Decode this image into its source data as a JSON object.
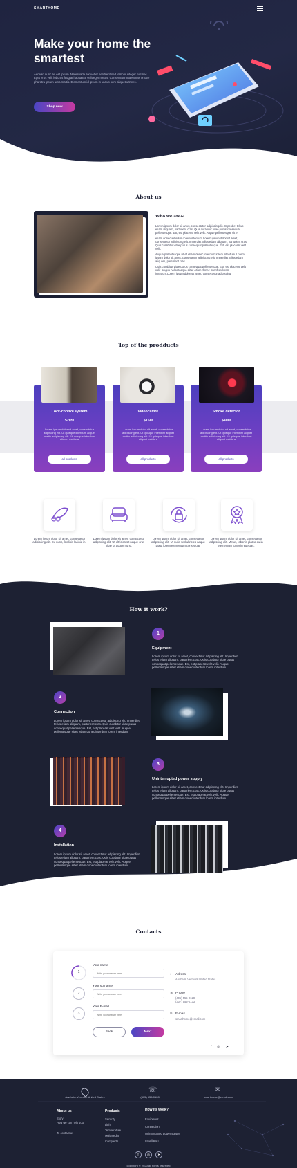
{
  "header": {
    "logo": "SMARTHOME",
    "menu_icon": "hamburger-icon"
  },
  "hero": {
    "title": "Make your home the smartest",
    "text": "Aenean nunc ac est ipsum. Malesuada aliquet et hendrerit sed tempor integer nisl nec. Eget eros velit lobortis feugiat habitasse velit eget metus. Consectetur maecenas ornare pharetra ipsum urna mattis. Elementum id ipsum in varius sem aliquet ultrices.",
    "button": "Shop now"
  },
  "about": {
    "title": "About us",
    "heading": "Who we are&",
    "p1": "Lorem ipsum dolor sit amet, consectetur adipiscingelit. Imperdiet tellus etiam aliquam, parturient cras. Quis curabitur vitae purus consequat pellentesque. Est, est placerat velit velit. Augue pellentesque sit et",
    "p2": "etiam donec interdum lorem interdum.Lorem ipsum dolor sit amet, consectetur adipiscing elit. Imperdiet tellus etiam aliquam, parturient cras. Quis curabitur vitae purus consequat pellentesque. Est, est placerat velit velit.",
    "p3": "Augue pellentesque sit et etiam donec interdum lorem interdum. Lorem ipsum dolor sit amet, consectetur adipiscing elit. Imperdiet tellus etiam aliquam, parturient cras.",
    "p4": "Quis curabitur vitae purus consequat pellentesque. Est, est placerat velit velit. Augue pellentesque sit et etiam donec interdum lorem interdum.Lorem ipsum dolor sit amet, consectetur adipiscing"
  },
  "products": {
    "title": "Top of the prodducts",
    "items": [
      {
        "name": "Lock-control system",
        "price": "$205/",
        "text": "Lorem ipsum dolor sit amet, consectetur adipiscing elit. Ut quisque interdum aliquet mattis adipiscing elit. Ut quisque interdum aliquet mattis a",
        "button": "all products"
      },
      {
        "name": "videocamre",
        "price": "$150/",
        "text": "Lorem ipsum dolor sit amet, consectetur adipiscing elit. Ut quisque interdum aliquet mattis adipiscing elit. Ut quisque interdum aliquet mattis a",
        "button": "all products"
      },
      {
        "name": "Smoke detector",
        "price": "$400/",
        "text": "Lorem ipsum dolor sit amet, consectetur adipiscing elit. Ut quisque interdum aliquet mattis adipiscing elit. Ut quisque interdum aliquet mattis a",
        "button": "all products"
      }
    ]
  },
  "features": [
    {
      "icon": "eco-leaf-icon",
      "text": "Lorem ipsum dolor sit amet, consectetur adipiscing elit. Eu nunc, facilisis lacinia in."
    },
    {
      "icon": "armchair-icon",
      "text": "Lorem ipsum dolor sit amet, consectetur adipiscing elit. Ut ultricies sit neque cras vitae ut augue nunc."
    },
    {
      "icon": "lock-refresh-icon",
      "text": "Lorem ipsum dolor sit amet, consectetur adipiscing elit. Ut nulla sed ultricies neque porta lorem elementum consequat."
    },
    {
      "icon": "award-badge-icon",
      "text": "Lorem ipsum dolor sit amet, consectetur adipiscing elit. Metus, lobortis platea eu in elementum tortor in egestas."
    }
  ],
  "how": {
    "title": "How it work?",
    "steps": [
      {
        "num": "1",
        "title": "Equipment",
        "text": "Lorem ipsum dolor sit amet, consectetur adipiscing elit. Imperdiet tellus etiam aliquam, parturient cras. Quis curabitur vitae purus consequat pellentesque. Est, est placerat velit velit. Augue pellentesque sit et etiam donec interdum lorem interdum."
      },
      {
        "num": "2",
        "title": "Connection",
        "text": "Lorem ipsum dolor sit amet, consectetur adipiscing elit. Imperdiet tellus etiam aliquam, parturient cras. Quis curabitur vitae purus consequat pellentesque. Est, est placerat velit velit. Augue pellentesque sit et etiam donec interdum lorem interdum."
      },
      {
        "num": "3",
        "title": "Uninterrupted power supply",
        "text": "Lorem ipsum dolor sit amet, consectetur adipiscing elit. Imperdiet tellus etiam aliquam, parturient cras. Quis curabitur vitae purus consequat pellentesque. Est, est placerat velit velit. Augue pellentesque sit et etiam donec interdum lorem interdum."
      },
      {
        "num": "4",
        "title": "Installation",
        "text": "Lorem ipsum dolor sit amet, consectetur adipiscing elit. Imperdiet tellus etiam aliquam, parturient cras. Quis curabitur vitae purus consequat pellentesque. Est, est placerat velit velit. Augue pellentesque sit et etiam donec interdum lorem interdum."
      }
    ]
  },
  "contacts": {
    "title": "Contacts",
    "fields": [
      {
        "num": "1",
        "label": "Your name",
        "placeholder": "Write your answer here"
      },
      {
        "num": "2",
        "label": "Your surname",
        "placeholder": "Write your answer here"
      },
      {
        "num": "3",
        "label": "Your E-mail",
        "placeholder": "Write your answer here"
      }
    ],
    "back": "Back",
    "next": "Next",
    "address_label": "Adress",
    "address": "Anaheim Vermont United States",
    "phone_label": "Phone",
    "phone1": "(405) 555-0128",
    "phone2": "(307) 555-0133",
    "email_label": "E-mail",
    "email": "smarthome@email.com"
  },
  "footer": {
    "address": "Anaheim Vermont United States",
    "phone": "(405) 555-0128",
    "email": "smarthome@email.com",
    "col1_title": "About us",
    "col1": [
      "Story",
      "How we can help you",
      "To contact us"
    ],
    "col2_title": "Products",
    "col2": [
      "Security",
      "Light",
      "Temperature",
      "Multimedia",
      "Complects"
    ],
    "col3_title": "How its work?",
    "col3": [
      "Equipment",
      "Connection",
      "Uninterrupted power supply",
      "Installation"
    ],
    "copyright": "copyright © 2020 all rights reserved"
  }
}
